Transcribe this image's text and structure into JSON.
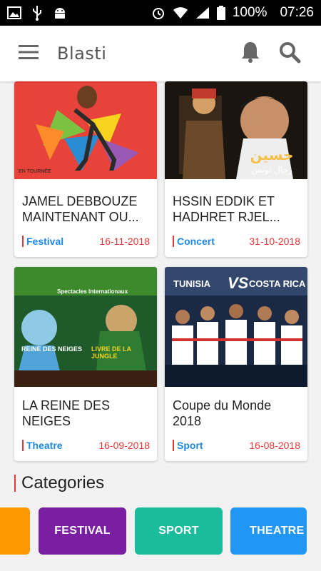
{
  "status_bar": {
    "battery": "100%",
    "time": "07:26",
    "icons": [
      "image-icon",
      "usb-icon",
      "android-icon",
      "alarm-icon",
      "wifi-icon",
      "signal-icon",
      "battery-icon"
    ]
  },
  "app_bar": {
    "title": "Blasti",
    "icons": [
      "menu-icon",
      "bell-icon",
      "search-icon"
    ]
  },
  "events": [
    {
      "title": "JAMEL DEBBOUZE MAINTENANT OU...",
      "category": "Festival",
      "date": "16-11-2018"
    },
    {
      "title": "HSSIN EDDIK ET HADHRET RJEL...",
      "category": "Concert",
      "date": "31-10-2018"
    },
    {
      "title": "LA REINE DES NEIGES",
      "category": "Theatre",
      "date": "16-09-2018"
    },
    {
      "title": "Coupe du Monde 2018",
      "category": "Sport",
      "date": "16-08-2018"
    }
  ],
  "poster_text": {
    "p1": "EN TOURNÉE",
    "p3_top": "Spectacles Internationaux",
    "p3_left": "REINE DES NEIGES",
    "p3_right": "LIVRE DE LA JUNGLE",
    "p4_left": "TUNISIA",
    "p4_vs": "VS",
    "p4_right": "COSTA RICA"
  },
  "categories": {
    "heading": "Categories",
    "items": [
      {
        "label": "",
        "color": "#ff9800"
      },
      {
        "label": "FESTIVAL",
        "color": "#7b1fa2"
      },
      {
        "label": "SPORT",
        "color": "#1abc9c"
      },
      {
        "label": "THEATRE",
        "color": "#2196f3"
      }
    ]
  },
  "colors": {
    "accent_red": "#e53935",
    "category_blue": "#1e88e5"
  }
}
